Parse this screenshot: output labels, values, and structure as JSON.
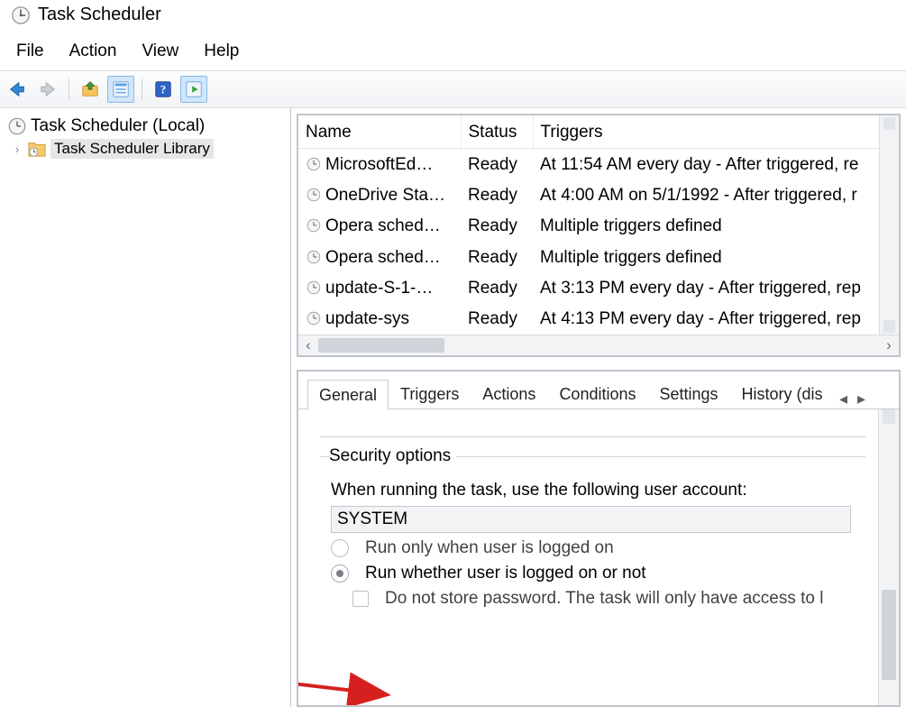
{
  "window": {
    "title": "Task Scheduler"
  },
  "menu": {
    "items": [
      "File",
      "Action",
      "View",
      "Help"
    ]
  },
  "tree": {
    "root": "Task Scheduler (Local)",
    "child": "Task Scheduler Library"
  },
  "tasklist": {
    "columns": [
      "Name",
      "Status",
      "Triggers"
    ],
    "rows": [
      {
        "name": "MicrosoftEd…",
        "status": "Ready",
        "triggers": "At 11:54 AM every day - After triggered, re"
      },
      {
        "name": "OneDrive Sta…",
        "status": "Ready",
        "triggers": "At 4:00 AM on 5/1/1992 - After triggered, r"
      },
      {
        "name": "Opera sched…",
        "status": "Ready",
        "triggers": "Multiple triggers defined"
      },
      {
        "name": "Opera sched…",
        "status": "Ready",
        "triggers": "Multiple triggers defined"
      },
      {
        "name": "update-S-1-…",
        "status": "Ready",
        "triggers": "At 3:13 PM every day - After triggered, rep"
      },
      {
        "name": "update-sys",
        "status": "Ready",
        "triggers": "At 4:13 PM every day - After triggered, rep"
      }
    ]
  },
  "tabs": {
    "items": [
      "General",
      "Triggers",
      "Actions",
      "Conditions",
      "Settings",
      "History (dis"
    ],
    "active_index": 0
  },
  "security": {
    "legend": "Security options",
    "prompt": "When running the task, use the following user account:",
    "account": "SYSTEM",
    "radio_logged_on": "Run only when user is logged on",
    "radio_logged_or_not": "Run whether user is logged on or not",
    "checkbox_no_store": "Do not store password.  The task will only have access to l"
  }
}
